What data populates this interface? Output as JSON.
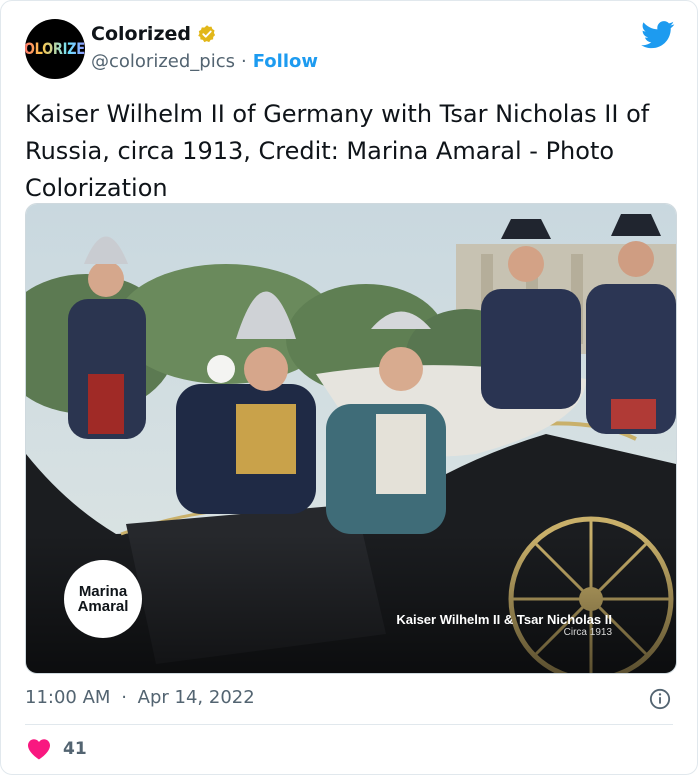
{
  "account": {
    "avatar_text": "COLORIZED",
    "display_name": "Colorized",
    "handle": "@colorized_pics",
    "separator": "·",
    "follow_label": "Follow"
  },
  "tweet": {
    "text": "Kaiser Wilhelm II of Germany with Tsar Nicholas II of Russia, circa 1913, Credit: Marina Amaral - Photo Colorization"
  },
  "media": {
    "logo_line1": "Marina",
    "logo_line2": "Amaral",
    "caption_title": "Kaiser Wilhelm II & Tsar Nicholas II",
    "caption_subtitle": "Circa 1913"
  },
  "meta": {
    "time": "11:00 AM",
    "separator": "·",
    "date": "Apr 14, 2022"
  },
  "engagement": {
    "like_count": "41"
  },
  "colors": {
    "twitter_blue": "#1d9bf0",
    "verified_gold": "#e2b719",
    "heart_pink": "#f91880",
    "text_primary": "#0f1419",
    "text_secondary": "#536471"
  },
  "icons": {
    "verified": "verified-badge-icon",
    "brand": "twitter-bird-icon",
    "info": "info-icon",
    "like": "heart-icon"
  }
}
